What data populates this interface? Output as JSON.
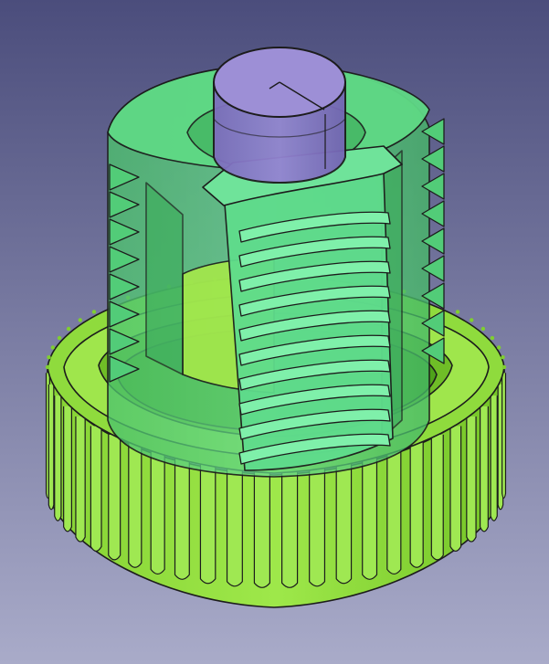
{
  "viewport": {
    "background_top": "#4b4d7c",
    "background_bottom": "#a9abc9"
  },
  "model": {
    "parts": [
      "knurled-ring",
      "collet-sleeve",
      "threaded-screw",
      "cap-cylinder"
    ],
    "colors": {
      "ring": "#8edb3c",
      "ring_dark": "#5fae1d",
      "ring_light": "#b7ef6a",
      "sleeve": "#55d07a",
      "sleeve_dark": "#34a85a",
      "screw": "#6fe39a",
      "cap": "#8677c6",
      "cap_top": "#9d8fd6",
      "edge": "#1c1c1c"
    }
  }
}
